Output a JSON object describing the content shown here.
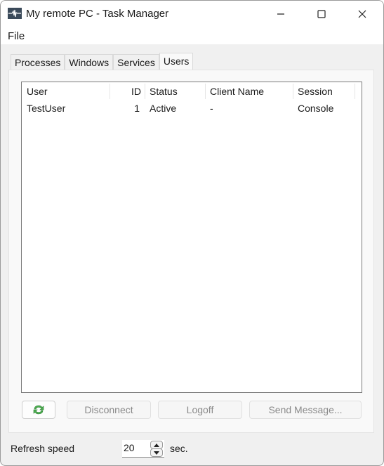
{
  "window": {
    "title": "My remote PC - Task Manager",
    "icon": "activity-monitor-icon",
    "controls": [
      "minimize-icon",
      "maximize-icon",
      "close-icon"
    ]
  },
  "menu": {
    "file": "File"
  },
  "tabs": [
    {
      "label": "Processes",
      "active": false
    },
    {
      "label": "Windows",
      "active": false
    },
    {
      "label": "Services",
      "active": false
    },
    {
      "label": "Users",
      "active": true
    }
  ],
  "users_table": {
    "columns": [
      "User",
      "ID",
      "Status",
      "Client Name",
      "Session"
    ],
    "rows": [
      {
        "user": "TestUser",
        "id": "1",
        "status": "Active",
        "client_name": "-",
        "session": "Console"
      }
    ]
  },
  "actions": {
    "refresh_icon": "refresh-icon",
    "disconnect": "Disconnect",
    "logoff": "Logoff",
    "send_message": "Send Message..."
  },
  "footer": {
    "refresh_label": "Refresh speed",
    "refresh_value": "20",
    "unit": "sec."
  },
  "colors": {
    "refresh_icon_green": "#4caf50"
  }
}
